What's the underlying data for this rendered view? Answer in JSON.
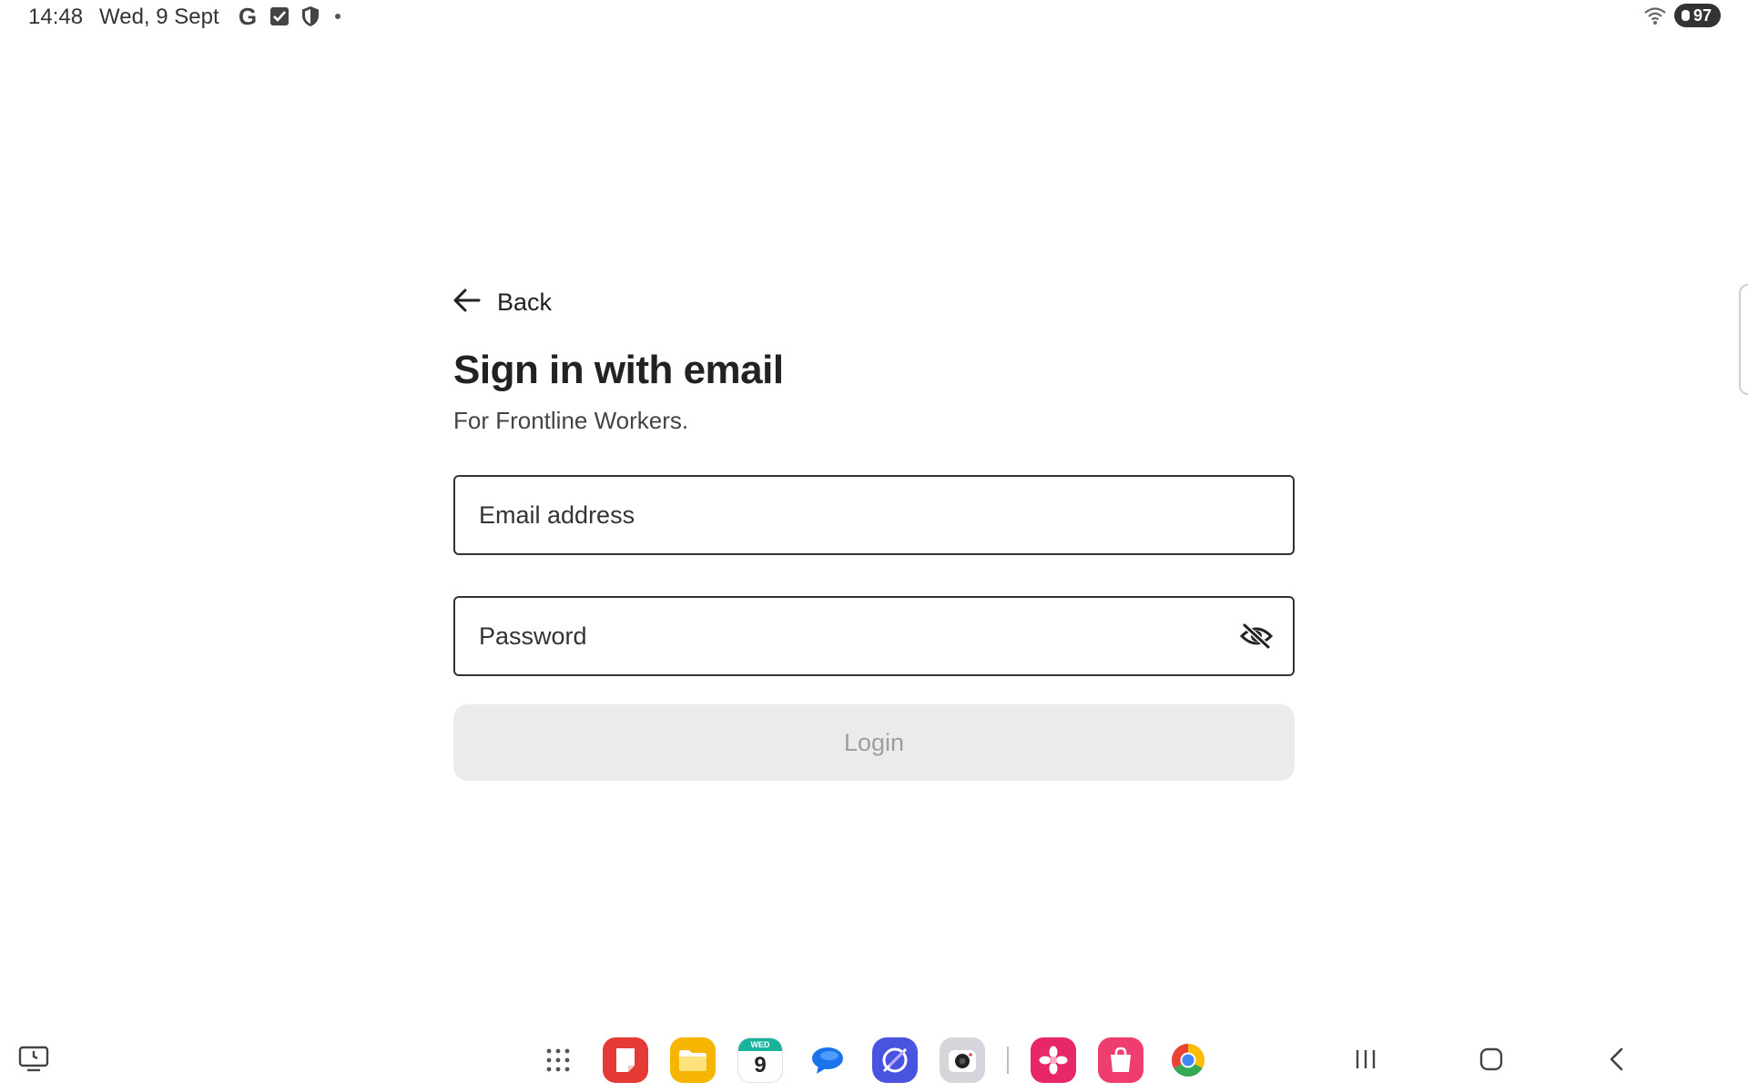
{
  "status_bar": {
    "time": "14:48",
    "date": "Wed, 9 Sept",
    "google_glyph": "G",
    "left_icons": [
      "google-icon",
      "checkbox-notification-icon",
      "shield-icon",
      "more-notifications-dot"
    ],
    "battery_level": "97",
    "right_icons": [
      "wifi-icon",
      "battery-icon"
    ]
  },
  "form": {
    "back_label": "Back",
    "title": "Sign in with email",
    "subtitle": "For Frontline Workers.",
    "email": {
      "placeholder": "Email address",
      "value": ""
    },
    "password": {
      "placeholder": "Password",
      "value": ""
    },
    "login_label": "Login",
    "login_enabled": false
  },
  "taskbar": {
    "calendar_weekday": "WED",
    "calendar_day": "9",
    "apps": [
      "app-drawer-icon",
      "notes-app-icon",
      "files-app-icon",
      "calendar-app-icon",
      "messages-app-icon",
      "internet-app-icon",
      "camera-app-icon",
      "gallery-app-icon",
      "store-app-icon",
      "chrome-app-icon"
    ],
    "nav": [
      "recents-button",
      "home-button",
      "back-nav-button"
    ]
  },
  "colors": {
    "text": "#222222",
    "field_border": "#333333",
    "login_disabled_bg": "#ebebeb",
    "login_disabled_text": "#9e9e9e",
    "calendar_accent": "#18b39a"
  }
}
